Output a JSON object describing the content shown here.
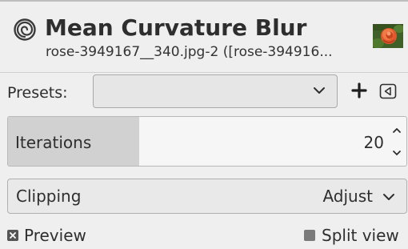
{
  "header": {
    "title": "Mean Curvature Blur",
    "subtitle": "rose-3949167__340.jpg-2 ([rose-394916...",
    "icon": "gegl-spiral-icon",
    "thumbnail": "rose-image-thumbnail"
  },
  "presets": {
    "label": "Presets:",
    "value": "",
    "add_icon": "plus-icon",
    "menu_icon": "menu-triangle-icon"
  },
  "iterations": {
    "label": "Iterations",
    "value": "20",
    "fill_fraction": 0.33
  },
  "clipping": {
    "label": "Clipping",
    "value": "Adjust"
  },
  "footer": {
    "preview_label": "Preview",
    "preview_checked": true,
    "split_view_label": "Split view",
    "split_view_checked": false
  },
  "colors": {
    "background": "#efefef",
    "text": "#2e2e2e",
    "slider_fill": "#d1d1d1"
  }
}
